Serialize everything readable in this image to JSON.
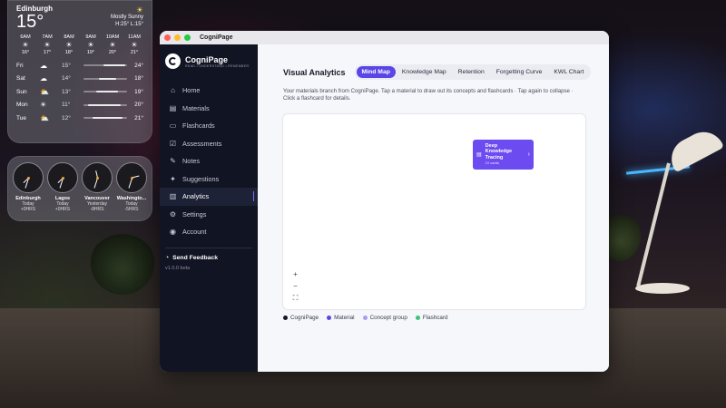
{
  "weather": {
    "city": "Edinburgh",
    "temp": "15°",
    "condition": "Mostly Sunny",
    "hilo": "H:25° L:15°",
    "hours": [
      {
        "time": "6AM",
        "icon": "sun-icon",
        "glyph": "☀",
        "temp": "16°"
      },
      {
        "time": "7AM",
        "icon": "sun-icon",
        "glyph": "☀",
        "temp": "17°"
      },
      {
        "time": "8AM",
        "icon": "sun-icon",
        "glyph": "☀",
        "temp": "18°"
      },
      {
        "time": "9AM",
        "icon": "sun-icon",
        "glyph": "☀",
        "temp": "19°"
      },
      {
        "time": "10AM",
        "icon": "sun-icon",
        "glyph": "☀",
        "temp": "20°"
      },
      {
        "time": "11AM",
        "icon": "sun-icon",
        "glyph": "☀",
        "temp": "21°"
      }
    ],
    "days": [
      {
        "day": "Fri",
        "icon": "cloud-icon",
        "glyph": "☁",
        "low": "15°",
        "high": "24°",
        "range": [
          0.45,
          0.95
        ]
      },
      {
        "day": "Sat",
        "icon": "cloud-icon",
        "glyph": "☁",
        "low": "14°",
        "high": "18°",
        "range": [
          0.35,
          0.75
        ]
      },
      {
        "day": "Sun",
        "icon": "partly-cloudy-icon",
        "glyph": "⛅",
        "low": "13°",
        "high": "19°",
        "range": [
          0.3,
          0.8
        ]
      },
      {
        "day": "Mon",
        "icon": "sun-icon",
        "glyph": "☀",
        "low": "11°",
        "high": "20°",
        "range": [
          0.1,
          0.85
        ]
      },
      {
        "day": "Tue",
        "icon": "partly-cloudy-icon",
        "glyph": "⛅",
        "low": "12°",
        "high": "21°",
        "range": [
          0.2,
          0.9
        ]
      }
    ]
  },
  "clocks": [
    {
      "city": "Edinburgh",
      "day": "Today",
      "offset": "+0HRS",
      "h": 7,
      "m": 33
    },
    {
      "city": "Lagos",
      "day": "Today",
      "offset": "+0HRS",
      "h": 7,
      "m": 33
    },
    {
      "city": "Vancouver",
      "day": "Yesterday",
      "offset": "-8HRS",
      "h": 11,
      "m": 33
    },
    {
      "city": "Washingto...",
      "day": "Today",
      "offset": "-5HRS",
      "h": 2,
      "m": 33
    }
  ],
  "app": {
    "window_title": "CogniPage",
    "brand_name": "CogniPage",
    "brand_tagline": "READ • UNDERSTAND • REMEMBER",
    "nav": [
      {
        "label": "Home",
        "icon": "home-icon",
        "glyph": "⌂",
        "active": false
      },
      {
        "label": "Materials",
        "icon": "document-icon",
        "glyph": "▤",
        "active": false
      },
      {
        "label": "Flashcards",
        "icon": "flashcard-icon",
        "glyph": "▭",
        "active": false
      },
      {
        "label": "Assessments",
        "icon": "assessment-icon",
        "glyph": "☑",
        "active": false
      },
      {
        "label": "Notes",
        "icon": "pencil-icon",
        "glyph": "✎",
        "active": false
      },
      {
        "label": "Suggestions",
        "icon": "lightbulb-icon",
        "glyph": "✦",
        "active": false
      },
      {
        "label": "Analytics",
        "icon": "chart-icon",
        "glyph": "▥",
        "active": true
      },
      {
        "label": "Settings",
        "icon": "gear-icon",
        "glyph": "⚙",
        "active": false
      },
      {
        "label": "Account",
        "icon": "user-icon",
        "glyph": "◉",
        "active": false
      }
    ],
    "feedback_label": "Send Feedback",
    "version": "v1.0.0 beta"
  },
  "analytics": {
    "title": "Visual Analytics",
    "tabs": [
      {
        "label": "Mind Map",
        "active": true
      },
      {
        "label": "Knowledge Map",
        "active": false
      },
      {
        "label": "Retention",
        "active": false
      },
      {
        "label": "Forgetting Curve",
        "active": false
      },
      {
        "label": "KWL Chart",
        "active": false
      }
    ],
    "description": "Your materials branch from CogniPage. Tap a material to draw out its concepts and flashcards · Tap again to collapse · Click a flashcard for details.",
    "node": {
      "title": "Deep Knowledge Tracing",
      "subtitle": "10 cards"
    },
    "zoom_in": "+",
    "zoom_out": "−",
    "fit": "⛶",
    "legend": [
      {
        "label": "CogniPage",
        "color": "#161826"
      },
      {
        "label": "Material",
        "color": "#5a46e6"
      },
      {
        "label": "Concept group",
        "color": "#a99cf2"
      },
      {
        "label": "Flashcard",
        "color": "#3cc47a"
      }
    ]
  }
}
